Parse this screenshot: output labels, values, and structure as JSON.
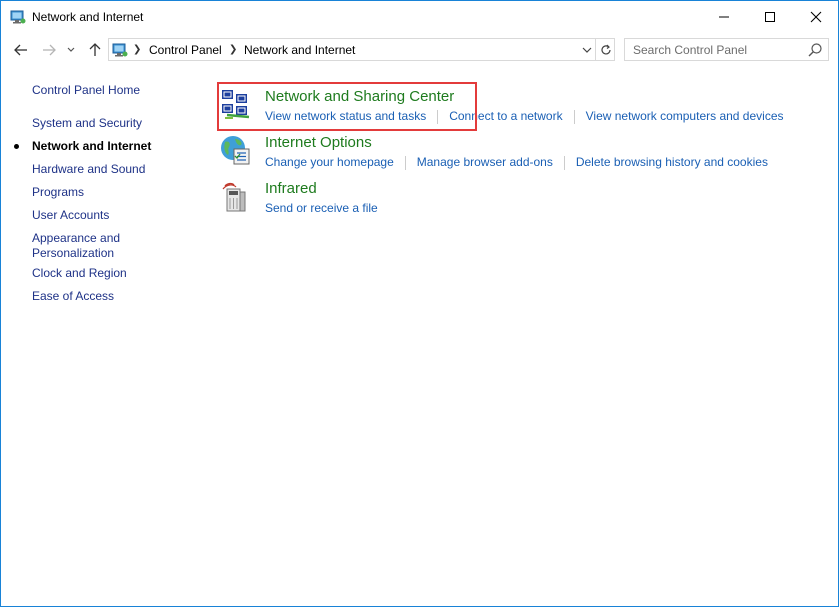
{
  "window": {
    "title": "Network and Internet"
  },
  "address": {
    "crumbs": [
      "Control Panel",
      "Network and Internet"
    ]
  },
  "search": {
    "placeholder": "Search Control Panel"
  },
  "sidebar": {
    "items": [
      {
        "label": "Control Panel Home"
      },
      {
        "label": "System and Security"
      },
      {
        "label": "Network and Internet",
        "current": true
      },
      {
        "label": "Hardware and Sound"
      },
      {
        "label": "Programs"
      },
      {
        "label": "User Accounts"
      },
      {
        "label": "Appearance and"
      },
      {
        "label": "Personalization"
      },
      {
        "label": "Clock and Region"
      },
      {
        "label": "Ease of Access"
      }
    ]
  },
  "categories": [
    {
      "title": "Network and Sharing Center",
      "icon": "network-sharing-icon",
      "links": [
        "View network status and tasks",
        "Connect to a network",
        "View network computers and devices"
      ]
    },
    {
      "title": "Internet Options",
      "icon": "internet-options-icon",
      "links": [
        "Change your homepage",
        "Manage browser add-ons",
        "Delete browsing history and cookies"
      ]
    },
    {
      "title": "Infrared",
      "icon": "infrared-icon",
      "links": [
        "Send or receive a file"
      ]
    }
  ],
  "colors": {
    "accent_border": "#1883d7",
    "category_title": "#1e7b1e",
    "link": "#1a5fb4",
    "highlight": "#e33b3b"
  }
}
